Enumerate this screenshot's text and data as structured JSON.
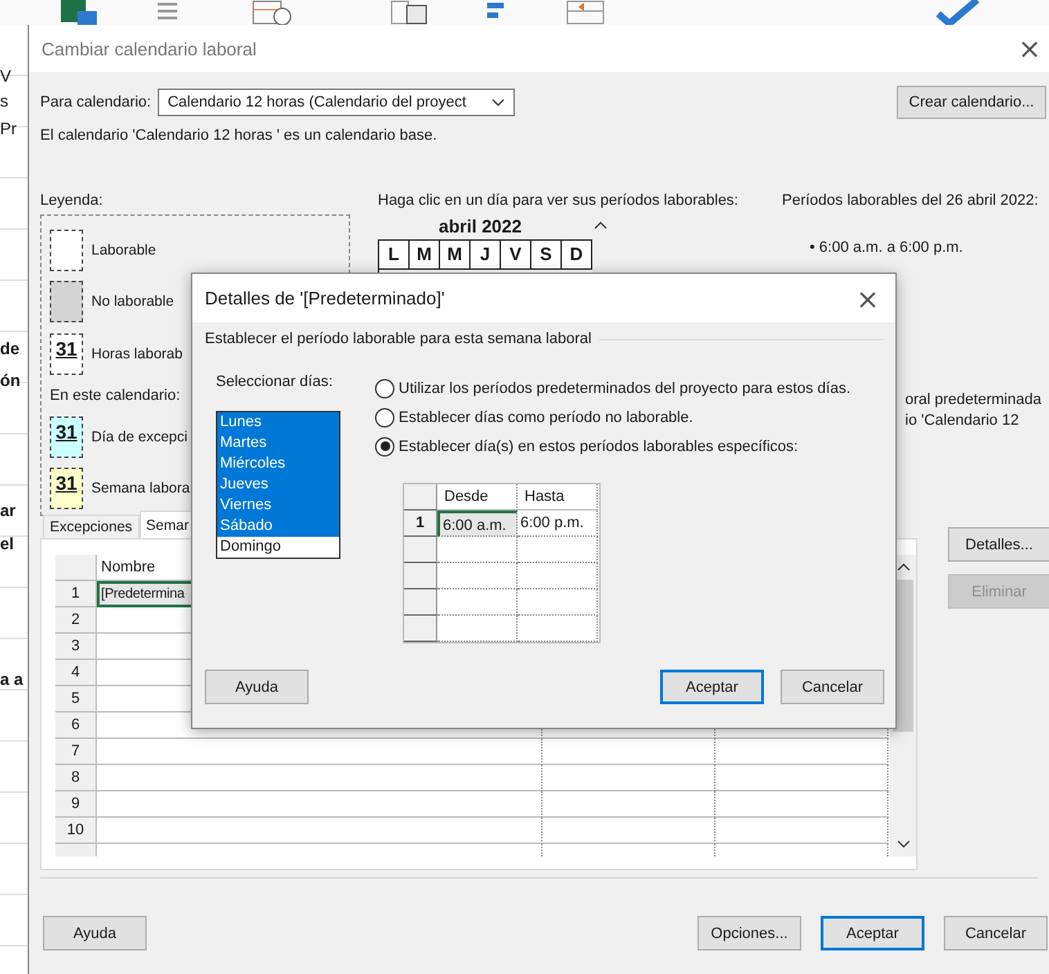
{
  "background_app": {
    "fragments": [
      {
        "text": "V",
        "bold": false
      },
      {
        "text": "s",
        "bold": false
      },
      {
        "text": "Pr",
        "bold": false
      },
      {
        "text": "de",
        "bold": true
      },
      {
        "text": "ón",
        "bold": true
      },
      {
        "text": "ar",
        "bold": true
      },
      {
        "text": "el",
        "bold": true
      },
      {
        "text": "a a",
        "bold": true
      }
    ]
  },
  "window": {
    "title": "Cambiar calendario laboral",
    "close": "×"
  },
  "calendar_select": {
    "label": "Para calendario:",
    "value": "Calendario 12 horas  (Calendario del proyect"
  },
  "create_button": "Crear calendario...",
  "info": "El calendario 'Calendario 12 horas ' es un calendario base.",
  "legend": {
    "title": "Leyenda:",
    "items": [
      {
        "kind": "plain",
        "color": "#ffffff",
        "label": "Laborable"
      },
      {
        "kind": "plain",
        "color": "#d4d4d4",
        "label": "No laborable"
      },
      {
        "kind": "day",
        "color": "#ffffff",
        "number": "31",
        "label": "Horas laborab"
      }
    ],
    "in_calendar_label": "En este calendario:",
    "in_calendar_items": [
      {
        "kind": "day",
        "color": "#ccffff",
        "number": "31",
        "label": "Día de excepci"
      },
      {
        "kind": "day",
        "color": "#ffffcc",
        "number": "31",
        "label": "Semana labora"
      }
    ]
  },
  "calendar": {
    "prompt": "Haga clic en un día para ver sus períodos laborables:",
    "month": "abril 2022",
    "weekdays": [
      "L",
      "M",
      "M",
      "J",
      "V",
      "S",
      "D"
    ]
  },
  "periods": {
    "title": "Períodos laborables del 26 abril 2022:",
    "items": [
      "• 6:00 a.m. a 6:00 p.m."
    ],
    "note_lines": [
      "oral predeterminada",
      "io 'Calendario 12"
    ]
  },
  "tabs": [
    {
      "label": "Excepciones",
      "selected": false
    },
    {
      "label": "Semar",
      "selected": true
    }
  ],
  "weeks_table": {
    "columns": [
      "Nombre"
    ],
    "rows": [
      {
        "num": "1",
        "name": "[Predetermina",
        "selected": true
      },
      {
        "num": "2",
        "selected": false
      },
      {
        "num": "3",
        "selected": false
      },
      {
        "num": "4",
        "selected": false
      },
      {
        "num": "5",
        "selected": false
      },
      {
        "num": "6",
        "selected": false
      },
      {
        "num": "7",
        "selected": false
      },
      {
        "num": "8",
        "selected": false
      },
      {
        "num": "9",
        "selected": false
      },
      {
        "num": "10",
        "selected": false
      }
    ]
  },
  "side_buttons": [
    {
      "label": "Detalles...",
      "disabled": false
    },
    {
      "label": "Eliminar",
      "disabled": true
    }
  ],
  "footer_buttons": [
    {
      "label": "Ayuda",
      "default": false
    },
    {
      "label": "Opciones...",
      "default": false
    },
    {
      "label": "Aceptar",
      "default": true
    },
    {
      "label": "Cancelar",
      "default": false
    }
  ],
  "details_dialog": {
    "title": "Detalles de '[Predeterminado]'",
    "close": "×",
    "subtitle": "Establecer el período laborable para esta semana laboral",
    "days_label": "Seleccionar días:",
    "days": [
      {
        "label": "Lunes",
        "selected": true
      },
      {
        "label": "Martes",
        "selected": true
      },
      {
        "label": "Miércoles",
        "selected": true
      },
      {
        "label": "Jueves",
        "selected": true
      },
      {
        "label": "Viernes",
        "selected": true
      },
      {
        "label": "Sábado",
        "selected": true
      },
      {
        "label": "Domingo",
        "selected": false
      }
    ],
    "options": [
      {
        "label": "Utilizar los períodos predeterminados del proyecto para estos días.",
        "selected": false
      },
      {
        "label": "Establecer días como período no laborable.",
        "selected": false
      },
      {
        "label": "Establecer día(s) en estos períodos laborables específicos:",
        "selected": true
      }
    ],
    "times": {
      "columns": [
        "Desde",
        "Hasta"
      ],
      "rows": [
        {
          "num": "1",
          "from": "6:00 a.m.",
          "to": "6:00 p.m.",
          "selected": true
        }
      ]
    },
    "buttons": [
      {
        "label": "Ayuda",
        "default": false
      },
      {
        "label": "Aceptar",
        "default": true
      },
      {
        "label": "Cancelar",
        "default": false
      }
    ]
  }
}
